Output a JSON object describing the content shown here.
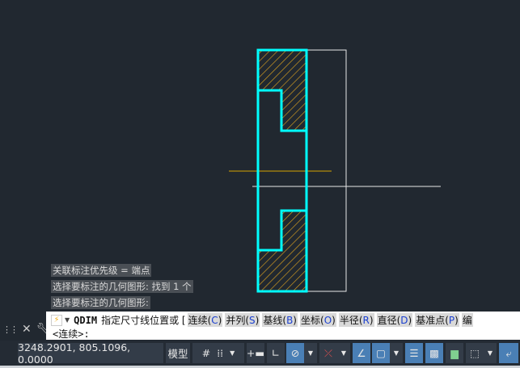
{
  "drawing": {
    "colors": {
      "outline": "#00ffff",
      "hatch": "#d9a020",
      "aux": "#ffffff",
      "axis": "#9a7a10",
      "background": "#212830"
    }
  },
  "history": [
    "关联标注优先级 = 端点",
    "选择要标注的几何图形: 找到 1 个",
    "选择要标注的几何图形:"
  ],
  "command": {
    "name": "QDIM",
    "prompt": "指定尺寸线位置或 [",
    "options": [
      {
        "label": "连续",
        "key": "C"
      },
      {
        "label": "并列",
        "key": "S"
      },
      {
        "label": "基线",
        "key": "B"
      },
      {
        "label": "坐标",
        "key": "O"
      },
      {
        "label": "半径",
        "key": "R"
      },
      {
        "label": "直径",
        "key": "D"
      },
      {
        "label": "基准点",
        "key": "P"
      },
      {
        "label": "编",
        "key": ""
      }
    ],
    "line2": "<连续>:"
  },
  "status": {
    "coords": "3248.2901, 805.1096, 0.0000",
    "model": "模型"
  }
}
